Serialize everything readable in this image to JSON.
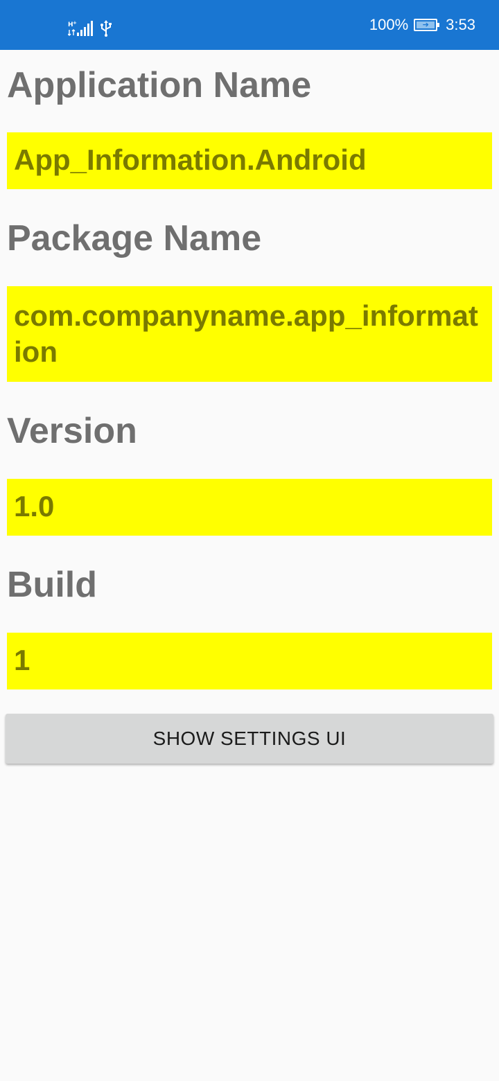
{
  "status_bar": {
    "network_type": "H+",
    "battery_percent": "100%",
    "time": "3:53",
    "icons": [
      "signal-icon",
      "usb-icon",
      "battery-charging-icon"
    ]
  },
  "fields": [
    {
      "label": "Application Name",
      "value": "App_Information.Android"
    },
    {
      "label": "Package Name",
      "value": "com.companyname.app_information"
    },
    {
      "label": "Version",
      "value": "1.0"
    },
    {
      "label": "Build",
      "value": "1"
    }
  ],
  "button": {
    "label": "SHOW SETTINGS UI"
  },
  "colors": {
    "status_bar": "#1976d2",
    "value_background": "#ffff00",
    "value_text": "#7a7a00",
    "label_text": "#6f6f6f",
    "button_background": "#d6d7d7"
  }
}
